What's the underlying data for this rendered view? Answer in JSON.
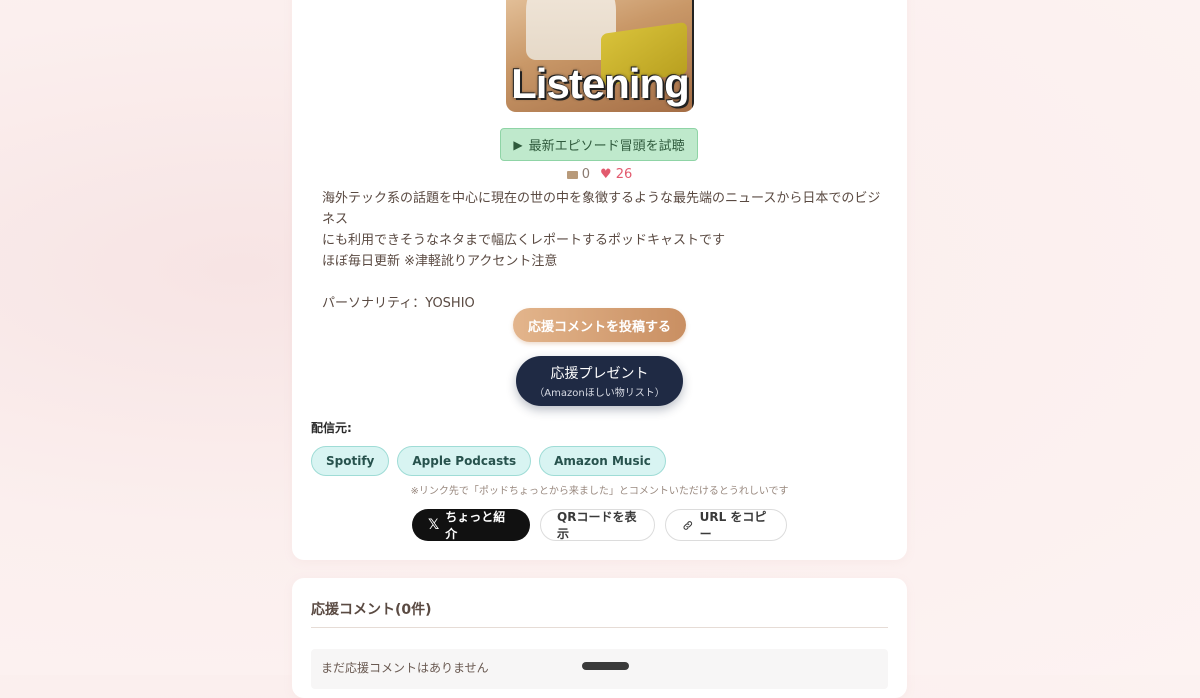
{
  "cover": {
    "text": "Listening",
    "image": "podcast-cover-person-with-laptop"
  },
  "trial_button": {
    "icon": "play-icon",
    "label": "最新エピソード冒頭を試聴"
  },
  "stats": {
    "comments": "0",
    "likes": "26"
  },
  "description": {
    "line1": "海外テック系の話題を中心に現在の世の中を象徴するような最先端のニュースから日本でのビジネス\nにも利用できそうなネタまで幅広くレポートするポッドキャストです",
    "line2": "ほぼ毎日更新 ※津軽訛りアクセント注意",
    "line3": "パーソナリティ：YOSHIO"
  },
  "support_button": {
    "label": "応援コメントを投稿する"
  },
  "present_button": {
    "label": "応援プレゼント",
    "sublabel": "（Amazonほしい物リスト）"
  },
  "sources": {
    "label": "配信元:",
    "items": [
      "Spotify",
      "Apple Podcasts",
      "Amazon Music"
    ],
    "note": "※リンク先で「ポッドちょっとから来ました」とコメントいただけるとうれしいです"
  },
  "share": {
    "x_label": "ちょっと紹介",
    "qr_label": "QRコードを表示",
    "url_label": "URL をコピー"
  },
  "comments": {
    "title": "応援コメント(0件)",
    "empty": "まだ応援コメントはありません"
  },
  "colors": {
    "trial_bg": "#bfe9cc",
    "support_btn": "#d9a57a",
    "present_btn": "#1f2a44",
    "source_pill": "#d8f4f2",
    "heart": "#e25a6e"
  }
}
